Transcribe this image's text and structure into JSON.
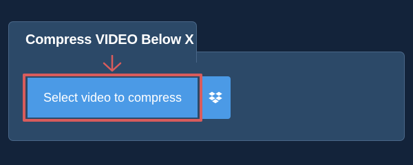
{
  "card": {
    "title": "Compress VIDEO Below X"
  },
  "select_button": {
    "label": "Select video to compress"
  },
  "icons": {
    "arrow": "arrow-down-icon",
    "dropbox": "dropbox-icon"
  },
  "colors": {
    "background": "#13233a",
    "card": "#2c4968",
    "button": "#4b9ae6",
    "highlight": "#d95c5c"
  }
}
